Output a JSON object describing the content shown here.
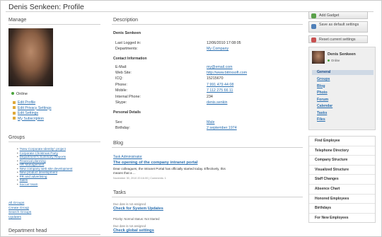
{
  "page": {
    "title": "Denis Senkeen: Profile"
  },
  "left": {
    "manage_heading": "Manage",
    "status": "Online",
    "actions": [
      "Edit Profile",
      "Edit Privacy Settings",
      "Edit Settings",
      "My Subscription"
    ],
    "groups_heading": "Groups",
    "groups": [
      "\"New Corporate Identity\" project",
      "Corporate Christmas Party",
      "Department's Summary Reports",
      "Financial planning",
      "HR Management",
      "New company web site development",
      "New product development",
      "PR and advertising",
      "Sales",
      "Soccer team"
    ],
    "group_links": [
      "All Groups",
      "Create Group",
      "Search Groups",
      "Updates"
    ],
    "department_head_heading": "Department head"
  },
  "description": {
    "heading": "Description",
    "name": "Denis Senkeen",
    "last_logged_label": "Last Logged in:",
    "last_logged_value": "12/06/2010 17:08:05",
    "departments_label": "Departments:",
    "departments_value": "My Company",
    "contact_heading": "Contact Information",
    "contacts": [
      {
        "label": "E-Mail:",
        "value": "my@email.com",
        "link": true
      },
      {
        "label": "Web Site:",
        "value": "http://www.bitrixsoft.com",
        "link": true
      },
      {
        "label": "ICQ:",
        "value": "15215670",
        "link": false
      },
      {
        "label": "Phone:",
        "value": "7 991 479 44 08",
        "link": true
      },
      {
        "label": "Mobile:",
        "value": "7 112 275 66 11",
        "link": true
      },
      {
        "label": "Internal Phone:",
        "value": "234",
        "link": false
      },
      {
        "label": "Skype:",
        "value": "denis.senkin",
        "link": true
      }
    ],
    "personal_heading": "Personal Details",
    "personal": [
      {
        "label": "Sex:",
        "value": "Male",
        "link": true
      },
      {
        "label": "Birthday:",
        "value": "2 september 1974",
        "link": true
      }
    ]
  },
  "blog": {
    "heading": "Blog",
    "author": "Task Administrator",
    "post_title": "The opening of the company intranet portal",
    "post_text": "Dear colleagues, the Intranet Portal has officially started today. Effectively, this means that a ...",
    "meta": "November 30, 2010 20:16:00 | Comments: 1"
  },
  "tasks": {
    "heading": "Tasks",
    "items": [
      {
        "due": "Due date is not assigned",
        "title": "Check for System Updates",
        "status": "Priority: Normal   Status: Not Started"
      },
      {
        "due": "Due date is not assigned",
        "title": "Check global settings"
      }
    ]
  },
  "sidebar": {
    "buttons": [
      "Add Gadget",
      "Save as default settings",
      "Reset current settings"
    ],
    "button_colors": [
      "#5aa04a",
      "#4f7fb8",
      "#c85050"
    ],
    "card_name": "Denis Senkeen",
    "card_status": "Online",
    "nav": [
      "General",
      "Groups",
      "Blog",
      "Photo",
      "Forum",
      "Calendar",
      "Tasks",
      "Files"
    ],
    "menu": [
      "Find Employee",
      "Telephone Directory",
      "Company Structure",
      "Visualized Structure",
      "Staff Changes",
      "Absence Chart",
      "Honored Employees",
      "Birthdays",
      "For New Employees"
    ]
  }
}
